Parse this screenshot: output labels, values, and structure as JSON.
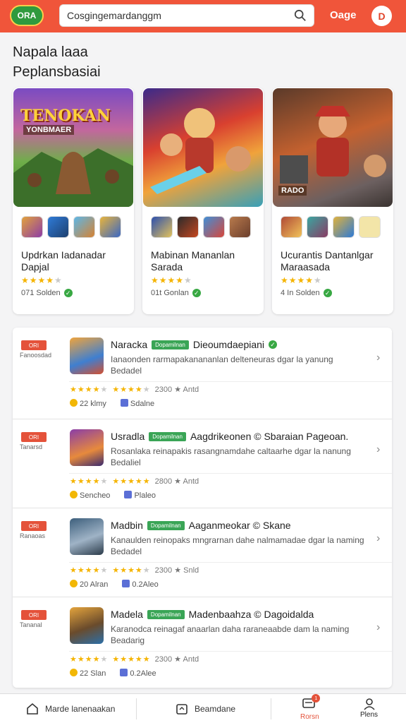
{
  "header": {
    "logo_text": "ORA",
    "search_value": "Cosgingemardanggm",
    "link_label": "Oage",
    "avatar_letter": "D"
  },
  "section": {
    "title_line1": "Napala laaa",
    "title_line2": "Peplansbasiai"
  },
  "featured": [
    {
      "art_title": "TENOKAN",
      "art_subtitle": "YONBMAER",
      "art_badge": "",
      "name": "Updrkan Iadanadar Dapjal",
      "rating": 3.5,
      "meta": "071 Solden"
    },
    {
      "art_title": "",
      "art_subtitle": "",
      "art_badge": "",
      "name": "Mabinan Mananlan Sarada",
      "rating": 3.5,
      "meta": "01t Gonlan"
    },
    {
      "art_title": "",
      "art_subtitle": "RADO",
      "art_badge": "",
      "name": "Ucurantis Dantanlgar Maraasada",
      "rating": 4,
      "meta": "4 In Solden"
    }
  ],
  "list": [
    {
      "tag": "ORI",
      "tag_sub": "Fanoosdad",
      "name": "Naracka",
      "pill": "Dopamilnan",
      "subtitle": "Dieoumdaepiani",
      "desc_line1": "Ianaonden rarmapakanananlan delteneuras dgar la yanung",
      "desc_line2": "Bedadel",
      "rating_a": 4,
      "rating_b": 3.5,
      "rating_text": "2300 ★ Antd",
      "foot1": "22 klmy",
      "foot2": "Sdalne"
    },
    {
      "tag": "ORI",
      "tag_sub": "Tanarsd",
      "name": "Usradla",
      "pill": "Dopamilnan",
      "subtitle": "Aagdrikeonen © Sbaraian Pageoan.",
      "desc_line1": "Rosanlaka reinapakis rasangnamdahe caltaarhe dgar la nanung",
      "desc_line2": "Bedaliel",
      "rating_a": 3.5,
      "rating_b": 5,
      "rating_text": "2800 ★ Antd",
      "foot1": "Sencheo",
      "foot2": "Plaleo"
    },
    {
      "tag": "ORI",
      "tag_sub": "Ranaoas",
      "name": "Madbin",
      "pill": "Dopamilnan",
      "subtitle": "Aaganmeokar © Skane",
      "desc_line1": "Kanaulden reinopaks mngrarnan dahe nalmamadae dgar la naming",
      "desc_line2": "Bedadel",
      "rating_a": 3.5,
      "rating_b": 4,
      "rating_text": "2300 ★ Snld",
      "foot1": "20 Alran",
      "foot2": "0.2Aleo"
    },
    {
      "tag": "ORI",
      "tag_sub": "Tananal",
      "name": "Madela",
      "pill": "Dopamilnan",
      "subtitle": "Madenbaahza © Dagoidalda",
      "desc_line1": "Karanodca reinagaf anaarlan daha raraneaabde dam la naming",
      "desc_line2": "Beadarig",
      "rating_a": 3.5,
      "rating_b": 5,
      "rating_text": "2300 ★ Antd",
      "foot1": "22 Slan",
      "foot2": "0.2Alee"
    }
  ],
  "bottom_nav": {
    "home_label": "Marde lanenaakan",
    "games_label": "Beamdane",
    "messages_label": "Rorsn",
    "messages_badge": "1",
    "profile_label": "Plens"
  },
  "colors": {
    "header_bg": "#f0553a",
    "accent_green": "#3aa556",
    "star": "#f5b400"
  }
}
